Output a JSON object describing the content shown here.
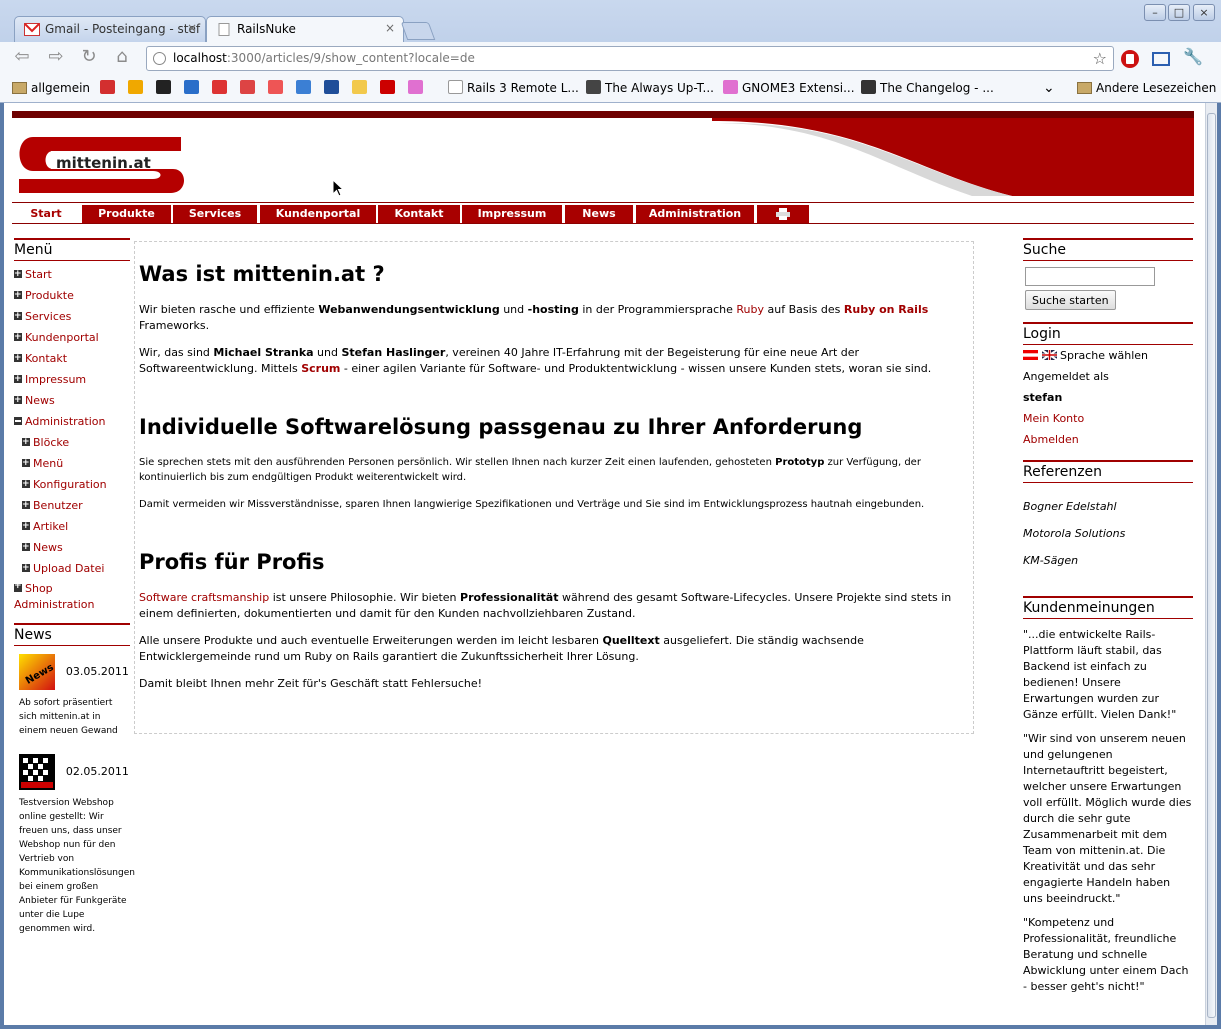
{
  "browser": {
    "tabs": [
      {
        "title": "Gmail - Posteingang - stef",
        "close": "×"
      },
      {
        "title": "RailsNuke",
        "close": "×"
      }
    ],
    "url_host": "localhost",
    "url_path": ":3000/articles/9/show_content?locale=de",
    "bookmarks": [
      {
        "label": "allgemein",
        "kind": "folder"
      },
      {
        "label": "Rails 3 Remote L..."
      },
      {
        "label": "The Always Up-T..."
      },
      {
        "label": "GNOME3 Extensi..."
      },
      {
        "label": "The Changelog - ..."
      },
      {
        "label": "Andere Lesezeichen",
        "kind": "folder"
      }
    ],
    "bookmark_icon_colors": [
      "#d32f2f",
      "#f0a800",
      "#222222",
      "#2a6ec9",
      "#d33",
      "#d44",
      "#e55",
      "#3b7fd4",
      "#1f4e99",
      "#f2c94c",
      "#cc0000",
      "#e070d0"
    ]
  },
  "header": {
    "logo_text": "mittenin.at"
  },
  "nav": {
    "items": [
      "Start",
      "Produkte",
      "Services",
      "Kundenportal",
      "Kontakt",
      "Impressum",
      "News",
      "Administration"
    ],
    "print_icon": "printer-icon"
  },
  "left": {
    "menu_title": "Menü",
    "menu": [
      {
        "label": "Start",
        "icon": "plus",
        "sub": false
      },
      {
        "label": "Produkte",
        "icon": "plus",
        "sub": false
      },
      {
        "label": "Services",
        "icon": "plus",
        "sub": false
      },
      {
        "label": "Kundenportal",
        "icon": "plus",
        "sub": false
      },
      {
        "label": "Kontakt",
        "icon": "plus",
        "sub": false
      },
      {
        "label": "Impressum",
        "icon": "plus",
        "sub": false
      },
      {
        "label": "News",
        "icon": "plus",
        "sub": false
      },
      {
        "label": "Administration",
        "icon": "minus",
        "sub": false
      },
      {
        "label": "Blöcke",
        "icon": "plus",
        "sub": true
      },
      {
        "label": "Menü",
        "icon": "plus",
        "sub": true
      },
      {
        "label": "Konfiguration",
        "icon": "plus",
        "sub": true
      },
      {
        "label": "Benutzer",
        "icon": "plus",
        "sub": true
      },
      {
        "label": "Artikel",
        "icon": "plus",
        "sub": true
      },
      {
        "label": "News",
        "icon": "plus",
        "sub": true
      },
      {
        "label": "Upload Datei",
        "icon": "plus",
        "sub": true
      }
    ],
    "shop_label_1": "Shop",
    "shop_label_2": "Administration",
    "news_title": "News",
    "news": [
      {
        "date": "03.05.2011",
        "text": "Ab sofort präsentiert sich mittenin.at in einem neuen Gewand"
      },
      {
        "date": "02.05.2011",
        "text": "Testversion Webshop online gestellt: Wir freuen uns, dass unser Webshop nun für den Vertrieb von Kommunikationslösungen bei einem großen Anbieter für Funkgeräte unter die Lupe genommen wird."
      }
    ]
  },
  "content": {
    "h1": "Was ist mittenin.at ?",
    "p1_a": "Wir bieten rasche und effiziente ",
    "p1_b": "Webanwendungsentwicklung",
    "p1_c": " und ",
    "p1_d": "-hosting",
    "p1_e": " in der Programmiersprache ",
    "p1_f": "Ruby",
    "p1_g": " auf Basis des ",
    "p1_h": "Ruby on Rails",
    "p1_i": " Frameworks.",
    "p2_a": "Wir, das sind ",
    "p2_b": "Michael Stranka",
    "p2_c": " und ",
    "p2_d": "Stefan Haslinger",
    "p2_e": ", vereinen 40 Jahre IT-Erfahrung mit der Begeisterung für eine neue Art der Softwareentwicklung. Mittels ",
    "p2_f": "Scrum",
    "p2_g": " - einer agilen Variante für Software- und Produktentwicklung - wissen unsere Kunden stets, woran sie sind.",
    "h2": "Individuelle Softwarelösung passgenau zu Ihrer Anforderung",
    "p3_a": "Sie sprechen stets mit den ausführenden Personen persönlich. Wir stellen Ihnen nach kurzer Zeit einen laufenden, gehosteten ",
    "p3_b": "Prototyp",
    "p3_c": " zur Verfügung, der kontinuierlich bis zum endgültigen Produkt weiterentwickelt wird.",
    "p4": "Damit vermeiden wir Missverständnisse, sparen Ihnen langwierige Spezifikationen und Verträge und Sie sind im Entwicklungsprozess hautnah eingebunden.",
    "h3": "Profis für Profis",
    "p5_a": "Software craftsmanship",
    "p5_b": " ist unsere Philosophie. Wir bieten ",
    "p5_c": "Professionalität",
    "p5_d": " während des gesamt Software-Lifecycles. Unsere Projekte sind stets in einem definierten, dokumentierten und damit für den Kunden nachvollziehbaren Zustand.",
    "p6_a": "Alle unsere Produkte und auch eventuelle Erweiterungen werden im leicht lesbaren ",
    "p6_b": "Quelltext",
    "p6_c": " ausgeliefert. Die ständig wachsende Entwicklergemeinde rund um Ruby on Rails garantiert die Zukunftssicherheit Ihrer Lösung.",
    "p7": "Damit bleibt Ihnen mehr Zeit für's Geschäft statt Fehlersuche!"
  },
  "right": {
    "search_title": "Suche",
    "search_value": "",
    "search_button": "Suche starten",
    "login_title": "Login",
    "language_label": "Sprache wählen",
    "logged_in_as": "Angemeldet als",
    "username": "stefan",
    "account_link": "Mein Konto",
    "logout_link": "Abmelden",
    "references_title": "Referenzen",
    "references": [
      "Bogner Edelstahl",
      "Motorola Solutions",
      "KM-Sägen"
    ],
    "opinions_title": "Kundenmeinungen",
    "opinions": [
      "\"...die entwickelte Rails-Plattform läuft stabil, das Backend ist einfach zu bedienen! Unsere Erwartungen wurden zur Gänze erfüllt. Vielen Dank!\"",
      "\"Wir sind von unserem neuen und gelungenen Internetauftritt begeistert, welcher unsere Erwartungen voll erfüllt. Möglich wurde dies durch die sehr gute Zusammenarbeit mit dem Team von mittenin.at. Die Kreativität und das sehr engagierte Handeln haben uns beeindruckt.\"",
      "\"Kompetenz und Professionalität, freundliche Beratung und schnelle Abwicklung unter einem Dach - besser geht's nicht!\""
    ]
  }
}
